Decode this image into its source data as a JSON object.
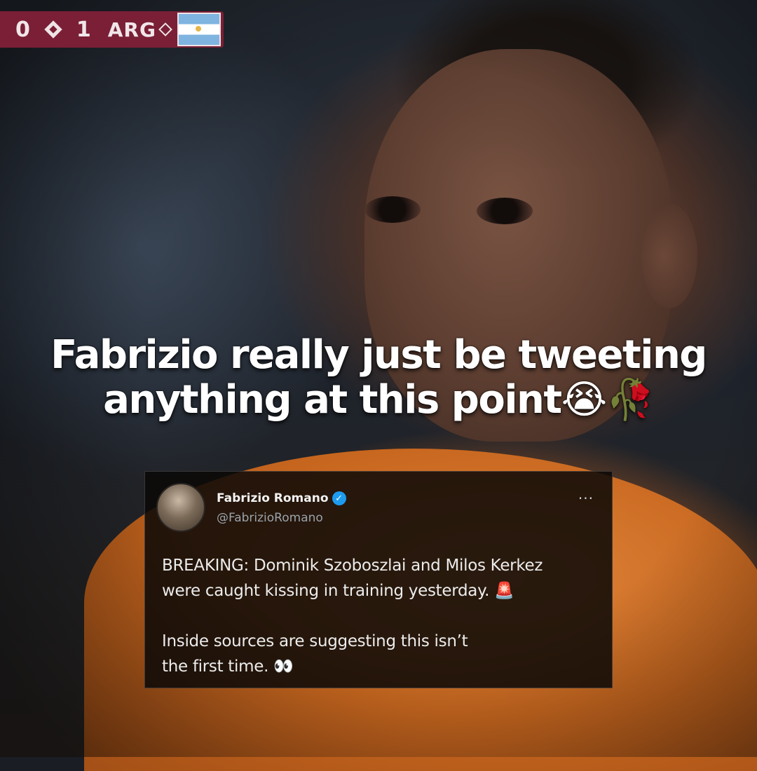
{
  "scoreboard": {
    "home_score": "0",
    "away_score": "1",
    "away_team": "ARG",
    "flag_icon": "argentina-flag-icon"
  },
  "caption": {
    "line1": "Fabrizio really just be tweeting",
    "line2": "anything at this point😭🥀"
  },
  "tweet": {
    "author_name": "Fabrizio Romano",
    "handle": "@FabrizioRomano",
    "verified_icon": "✓",
    "more_label": "···",
    "para1_line1": "BREAKING: Dominik Szoboszlai and Milos Kerkez",
    "para1_line2": "were caught kissing in training yesterday. 🚨",
    "para2_line1": "Inside sources are suggesting this isn’t",
    "para2_line2": "the first time. 👀"
  },
  "colors": {
    "scoreboard_bg": "#7a1f35",
    "jersey_orange": "#d9772e",
    "verified_blue": "#1d9bf0"
  }
}
